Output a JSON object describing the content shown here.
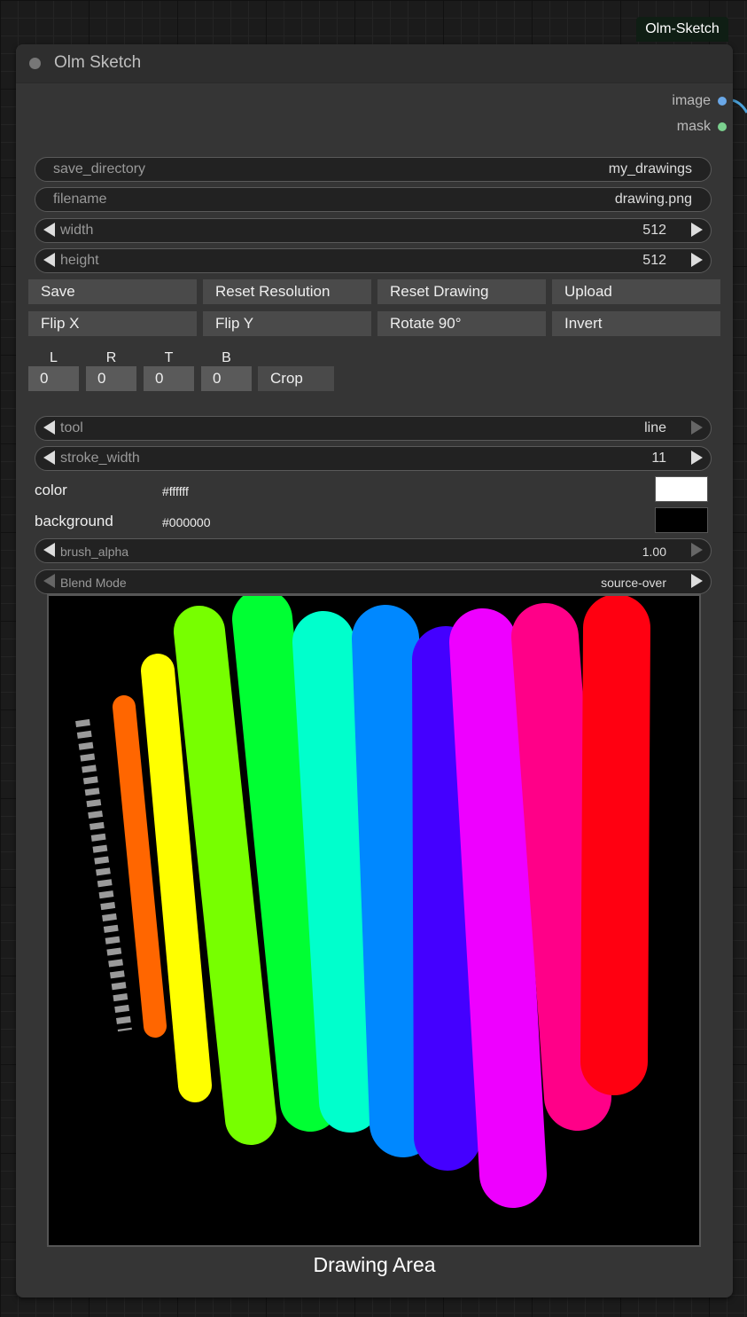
{
  "badge": "Olm-Sketch",
  "node": {
    "title": "Olm Sketch",
    "outputs": [
      {
        "label": "image",
        "color": "#6aa8e8"
      },
      {
        "label": "mask",
        "color": "#7bd18f"
      }
    ]
  },
  "fields": {
    "save_directory": {
      "label": "save_directory",
      "value": "my_drawings"
    },
    "filename": {
      "label": "filename",
      "value": "drawing.png"
    },
    "width": {
      "label": "width",
      "value": "512"
    },
    "height": {
      "label": "height",
      "value": "512"
    }
  },
  "buttons": {
    "row1": [
      "Save",
      "Reset Resolution",
      "Reset Drawing",
      "Upload"
    ],
    "row2": [
      "Flip X",
      "Flip Y",
      "Rotate 90°",
      "Invert"
    ]
  },
  "crop": {
    "labels": [
      "L",
      "R",
      "T",
      "B"
    ],
    "values": [
      "0",
      "0",
      "0",
      "0"
    ],
    "button": "Crop"
  },
  "tool": {
    "label": "tool",
    "value": "line"
  },
  "stroke_width": {
    "label": "stroke_width",
    "value": "11"
  },
  "color": {
    "label": "color",
    "hex": "#ffffff",
    "swatch": "#ffffff"
  },
  "background": {
    "label": "background",
    "hex": "#000000",
    "swatch": "#000000"
  },
  "brush_alpha": {
    "label": "brush_alpha",
    "value": "1.00"
  },
  "blend_mode": {
    "label": "Blend Mode",
    "value": "source-over"
  },
  "canvas": {
    "caption": "Drawing Area",
    "strokes": [
      {
        "color": "#ff6600",
        "width": "thin"
      },
      {
        "color": "#ffff00",
        "width": "medium"
      },
      {
        "color": "#77ff00",
        "width": "wide"
      },
      {
        "color": "#00ff33",
        "width": "wide"
      },
      {
        "color": "#00ffcc",
        "width": "wide"
      },
      {
        "color": "#0088ff",
        "width": "wide"
      },
      {
        "color": "#4400ff",
        "width": "wide"
      },
      {
        "color": "#ee00ff",
        "width": "wide"
      },
      {
        "color": "#ff0088",
        "width": "wide"
      },
      {
        "color": "#ff0011",
        "width": "wide"
      }
    ],
    "dashed_stroke_color": "#9a9a9a"
  }
}
